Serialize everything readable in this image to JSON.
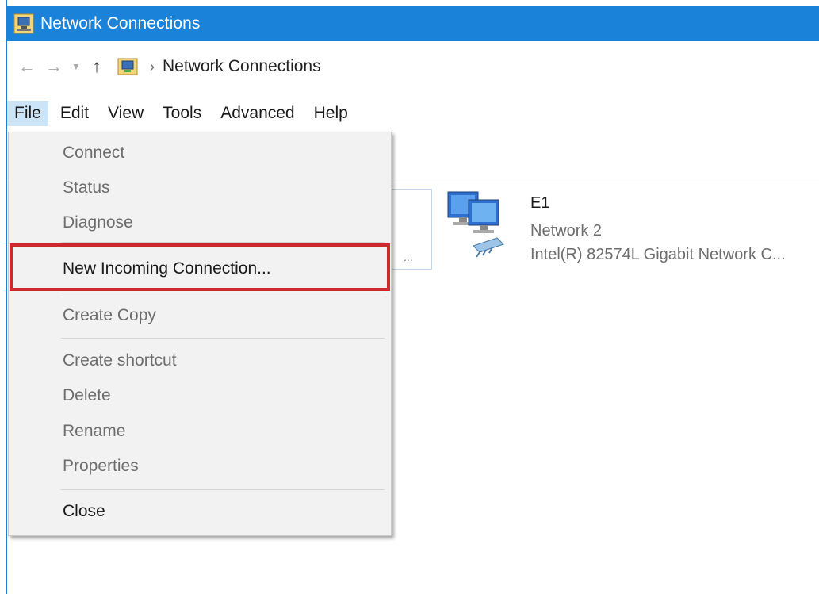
{
  "window": {
    "title": "Network Connections"
  },
  "address": {
    "crumb": "Network Connections"
  },
  "menubar": {
    "items": [
      "File",
      "Edit",
      "View",
      "Tools",
      "Advanced",
      "Help"
    ],
    "active": "File"
  },
  "file_menu": {
    "connect": "Connect",
    "status": "Status",
    "diagnose": "Diagnose",
    "new_incoming": "New Incoming Connection...",
    "create_copy": "Create Copy",
    "create_shortcut": "Create shortcut",
    "delete": "Delete",
    "rename": "Rename",
    "properties": "Properties",
    "close": "Close"
  },
  "adapter": {
    "name": "E1",
    "network": "Network  2",
    "device": "Intel(R) 82574L Gigabit Network C..."
  },
  "partial_card": {
    "ellipsis": "..."
  },
  "icons": {
    "title": "network-connections-icon",
    "back": "back-arrow-icon",
    "forward": "forward-arrow-icon",
    "recent": "chevron-down-icon",
    "up": "up-arrow-icon",
    "address": "network-folder-icon",
    "adapter": "network-adapter-icon"
  },
  "colors": {
    "titlebar": "#1a82d8",
    "highlight": "#cc2a2f",
    "menu_active": "#cce4f7"
  }
}
